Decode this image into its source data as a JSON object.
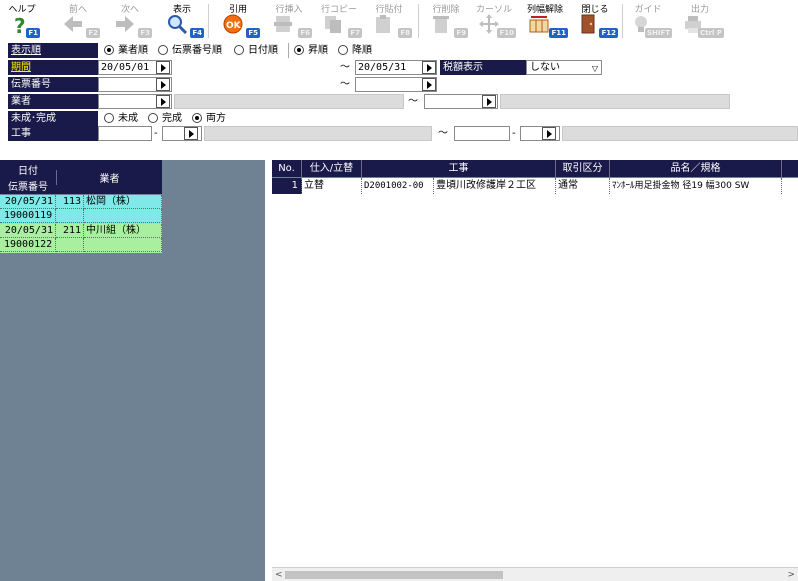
{
  "toolbar": {
    "items": [
      {
        "label": "ヘルプ",
        "fkey": "F1",
        "icon": "help-icon"
      },
      {
        "label": "前へ",
        "fkey": "F2",
        "icon": "arrow-left-icon"
      },
      {
        "label": "次へ",
        "fkey": "F3",
        "icon": "arrow-right-icon"
      },
      {
        "label": "表示",
        "fkey": "F4",
        "icon": "magnifier-icon"
      },
      {
        "label": "引用",
        "fkey": "F5",
        "icon": "ok-stamp-icon"
      },
      {
        "label": "行挿入",
        "fkey": "F6",
        "icon": "row-insert-icon"
      },
      {
        "label": "行コピー",
        "fkey": "F7",
        "icon": "row-copy-icon"
      },
      {
        "label": "行貼付",
        "fkey": "F8",
        "icon": "row-paste-icon"
      },
      {
        "label": "行削除",
        "fkey": "F9",
        "icon": "row-delete-icon"
      },
      {
        "label": "カーソル",
        "fkey": "F10",
        "icon": "cursor-cross-icon"
      },
      {
        "label": "列幅解除",
        "fkey": "F11",
        "icon": "column-width-icon"
      },
      {
        "label": "閉じる",
        "fkey": "F12",
        "icon": "door-icon"
      },
      {
        "label": "ガイド",
        "fkey": "SHIFT",
        "icon": "lightbulb-icon"
      },
      {
        "label": "出力",
        "fkey": "Ctrl P",
        "icon": "printer-icon"
      }
    ]
  },
  "form": {
    "order_label": "表示順",
    "order_options": [
      "業者順",
      "伝票番号順",
      "日付順"
    ],
    "sort_options": [
      "昇順",
      "降順"
    ],
    "period_label": "期間",
    "period_from": "20/05/01",
    "period_to": "20/05/31",
    "tax_label": "税額表示",
    "tax_value": "しない",
    "slip_label": "伝票番号",
    "vendor_label": "業者",
    "status_label": "未成･完成",
    "status_options": [
      "未成",
      "完成",
      "両方"
    ],
    "project_label": "工事",
    "tilde": "～",
    "dash": "-"
  },
  "left_list": {
    "header": {
      "date": "日付",
      "slip": "伝票番号",
      "vendor": "業者"
    },
    "rows": [
      {
        "date": "20/05/31",
        "code": "113",
        "vendor": "松岡（株）",
        "slip": "19000119",
        "color": "#7fe8e8"
      },
      {
        "date": "20/05/31",
        "code": "211",
        "vendor": "中川組（株）",
        "slip": "19000122",
        "color": "#a8f0a0"
      }
    ]
  },
  "grid": {
    "columns": [
      "No.",
      "仕入/立替",
      "工事",
      "取引区分",
      "品名／規格"
    ],
    "rows": [
      {
        "no": "1",
        "type": "立替",
        "project_code": "D2001002-00",
        "project_name": "豊頃川改修護岸２工区",
        "trade": "通常",
        "item": "ﾏﾝﾎｰﾙ用足掛金物 径19 幅300 SW"
      }
    ]
  }
}
